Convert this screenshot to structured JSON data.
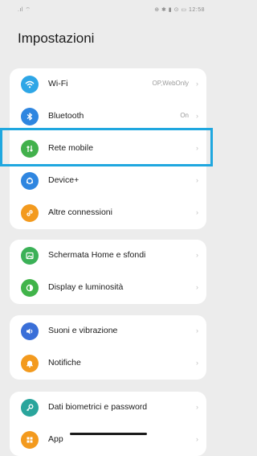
{
  "status_bar": {
    "left": ".ıl ⌔",
    "right": "⊕ ✱ ▮ ⊙ ▭ 12:58"
  },
  "title": "Impostazioni",
  "rows": {
    "wifi": {
      "label": "Wi-Fi",
      "value": "OP,WebOnly"
    },
    "bluetooth": {
      "label": "Bluetooth",
      "value": "On"
    },
    "mobile": {
      "label": "Rete mobile",
      "value": ""
    },
    "device": {
      "label": "Device+",
      "value": ""
    },
    "other": {
      "label": "Altre connessioni",
      "value": ""
    },
    "home": {
      "label": "Schermata Home e sfondi",
      "value": ""
    },
    "display": {
      "label": "Display e luminosità",
      "value": ""
    },
    "sound": {
      "label": "Suoni e vibrazione",
      "value": ""
    },
    "notif": {
      "label": "Notifiche",
      "value": ""
    },
    "bio": {
      "label": "Dati biometrici e password",
      "value": ""
    },
    "apps": {
      "label": "App",
      "value": ""
    }
  },
  "chevron": "›",
  "colors": {
    "wifi": "#2ea6e6",
    "bluetooth": "#2f86e0",
    "mobile": "#42b14c",
    "device": "#2f86e0",
    "other": "#f39a1e",
    "home": "#3bb157",
    "display": "#41b44a",
    "sound": "#3a6fd8",
    "notif": "#f39a1e",
    "bio": "#2aa59c",
    "apps": "#f39a1e",
    "highlight": "#1fa7df"
  },
  "icons": {
    "wifi": "wifi-icon",
    "bluetooth": "bluetooth-icon",
    "mobile": "mobile-network-icon",
    "device": "device-plus-icon",
    "other": "link-icon",
    "home": "image-icon",
    "display": "brightness-icon",
    "sound": "speaker-icon",
    "notif": "bell-icon",
    "bio": "key-icon",
    "apps": "apps-icon"
  }
}
